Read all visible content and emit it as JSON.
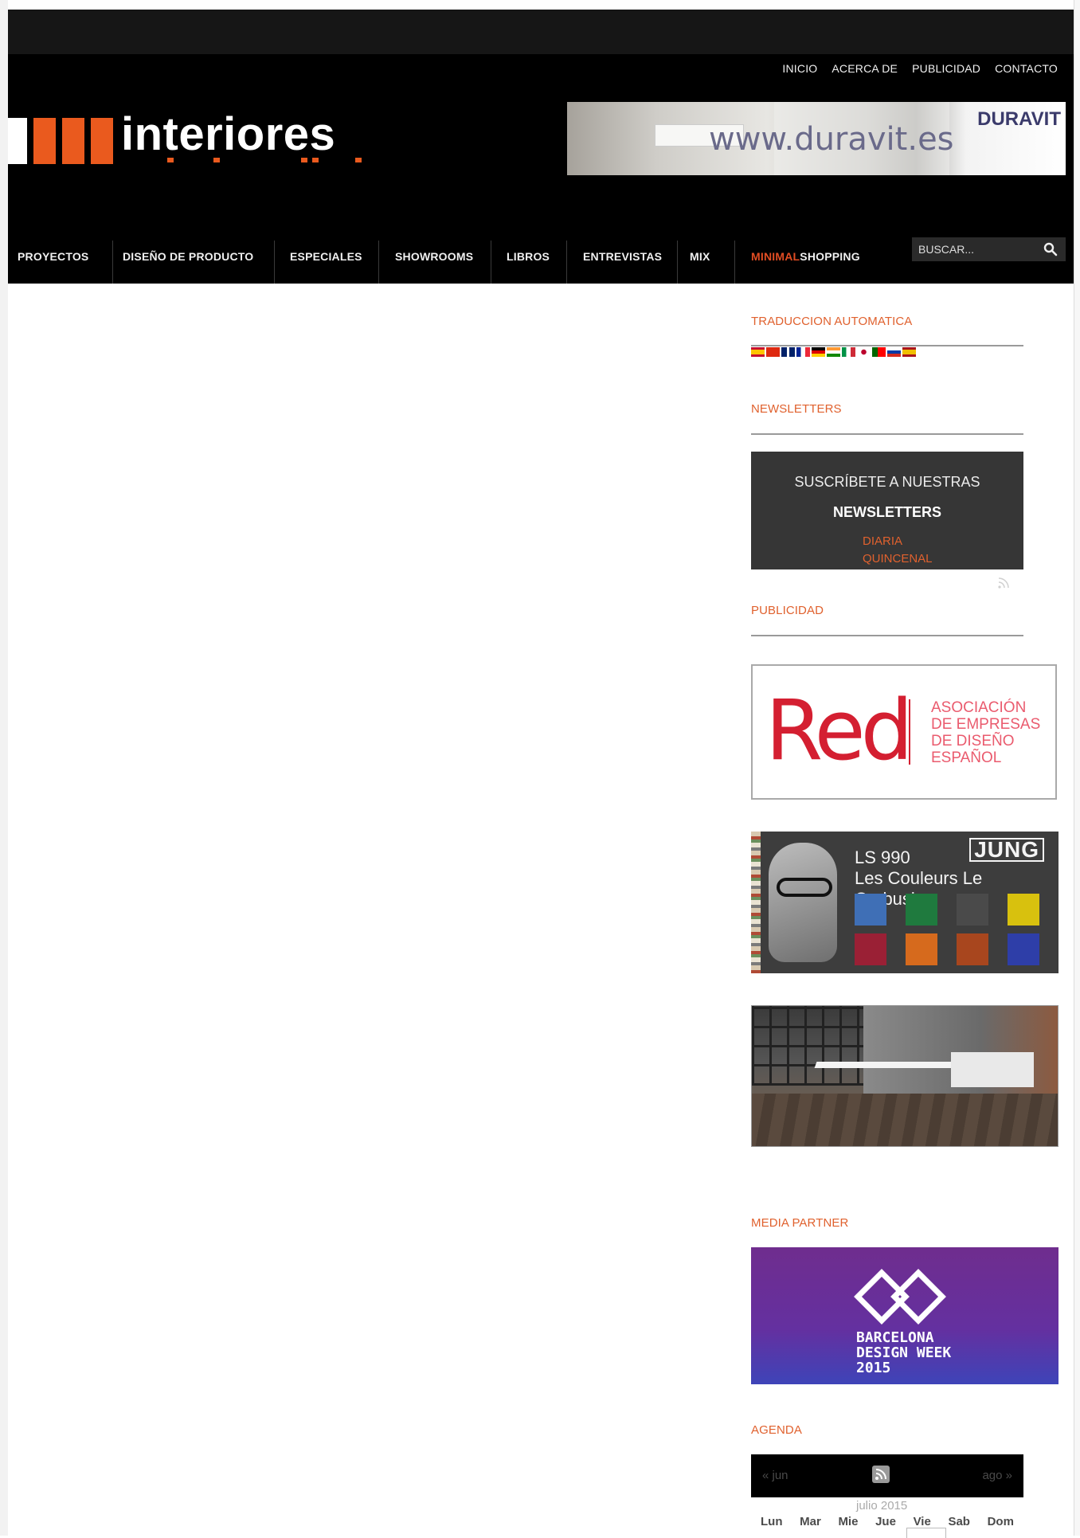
{
  "header": {
    "top_links": [
      "INICIO",
      "ACERCA DE",
      "PUBLICIDAD",
      "CONTACTO"
    ],
    "logo_text": "interiores",
    "colors": {
      "accent": "#ea5a1e",
      "header_bg": "#000000"
    }
  },
  "top_ad": {
    "url": "www.duravit.es",
    "brand": "DURAVIT"
  },
  "nav": {
    "items": [
      "PROYECTOS",
      "DISEÑO DE PRODUCTO",
      "ESPECIALES",
      "SHOWROOMS",
      "LIBROS",
      "ENTREVISTAS",
      "MIX"
    ],
    "shopping_accent": "MINIMAL",
    "shopping_rest": "SHOPPING",
    "search_placeholder": "BUSCAR..."
  },
  "sidebar": {
    "translation_title": "TRADUCCION AUTOMATICA",
    "newsletters_title": "NEWSLETTERS",
    "newsletter_box": {
      "line1": "SUSCRÍBETE A NUESTRAS",
      "line2": "NEWSLETTERS",
      "option1": "DIARIA",
      "option2": "QUINCENAL"
    },
    "advertising_title": "PUBLICIDAD",
    "ad_red": {
      "word": "Red",
      "text": [
        "ASOCIACIÓN",
        "DE EMPRESAS",
        "DE DISEÑO",
        "ESPAÑOL"
      ]
    },
    "ad_jung": {
      "model": "LS 990",
      "tagline": "Les Couleurs Le Corbusier",
      "brand": "JUNG"
    },
    "media_partner_title": "MEDIA PARTNER",
    "ad_bdw": {
      "lines": [
        "BARCELONA",
        "DESIGN WEEK",
        "2015"
      ]
    },
    "agenda_title": "AGENDA",
    "agenda": {
      "prev": "« jun",
      "next": "ago »",
      "month": "julio 2015",
      "days": [
        "Lun",
        "Mar",
        "Mie",
        "Jue",
        "Vie",
        "Sab",
        "Dom"
      ]
    }
  }
}
